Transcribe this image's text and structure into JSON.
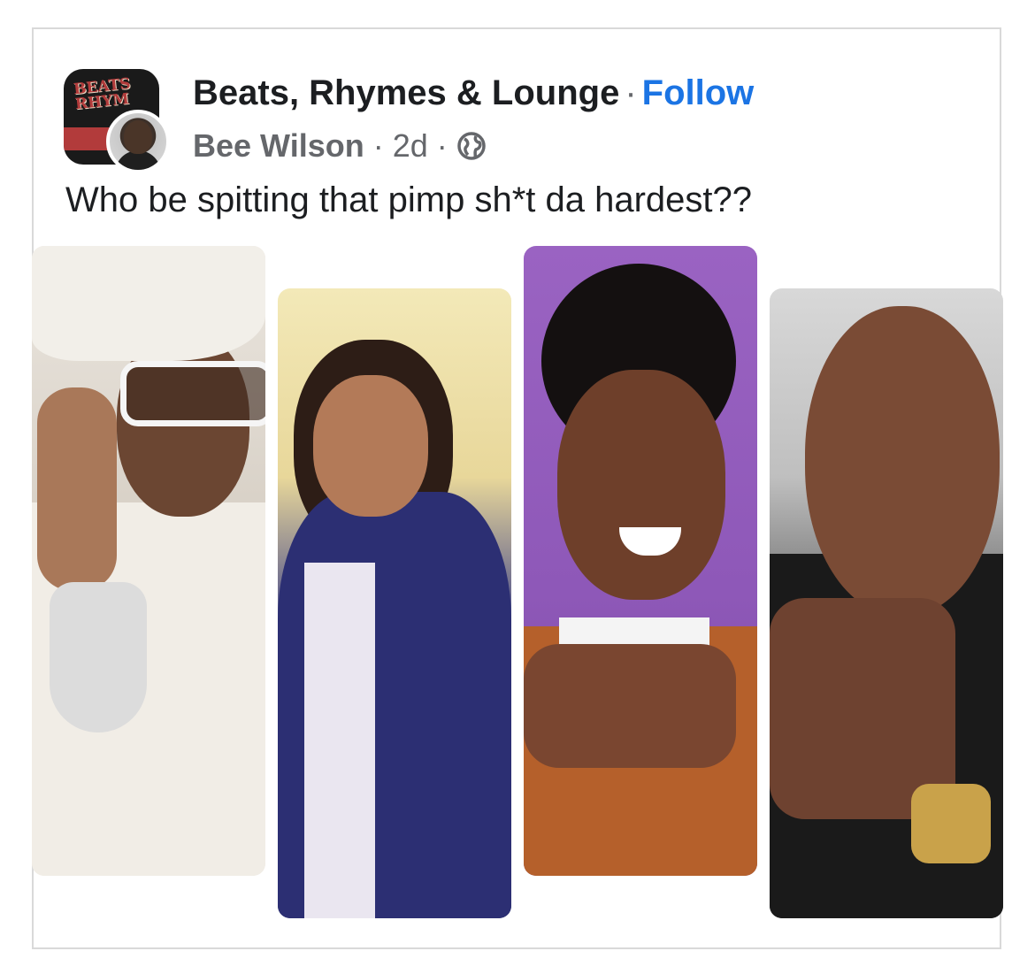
{
  "post": {
    "page_name": "Beats, Rhymes & Lounge",
    "separator": "·",
    "follow_label": "Follow",
    "author": "Bee Wilson",
    "time": "2d",
    "meta_separator": "·",
    "privacy_icon": "globe-icon",
    "text": "Who be spitting that pimp sh*t da hardest??"
  },
  "group_logo": {
    "line1": "BEATS",
    "line2": "RHYM"
  },
  "photos": [
    {
      "name": "photo-1"
    },
    {
      "name": "photo-2"
    },
    {
      "name": "photo-3"
    },
    {
      "name": "photo-4"
    }
  ],
  "colors": {
    "follow": "#1b74e4",
    "text": "#1c1e21",
    "meta": "#65676b",
    "border": "#d9d9d9"
  }
}
